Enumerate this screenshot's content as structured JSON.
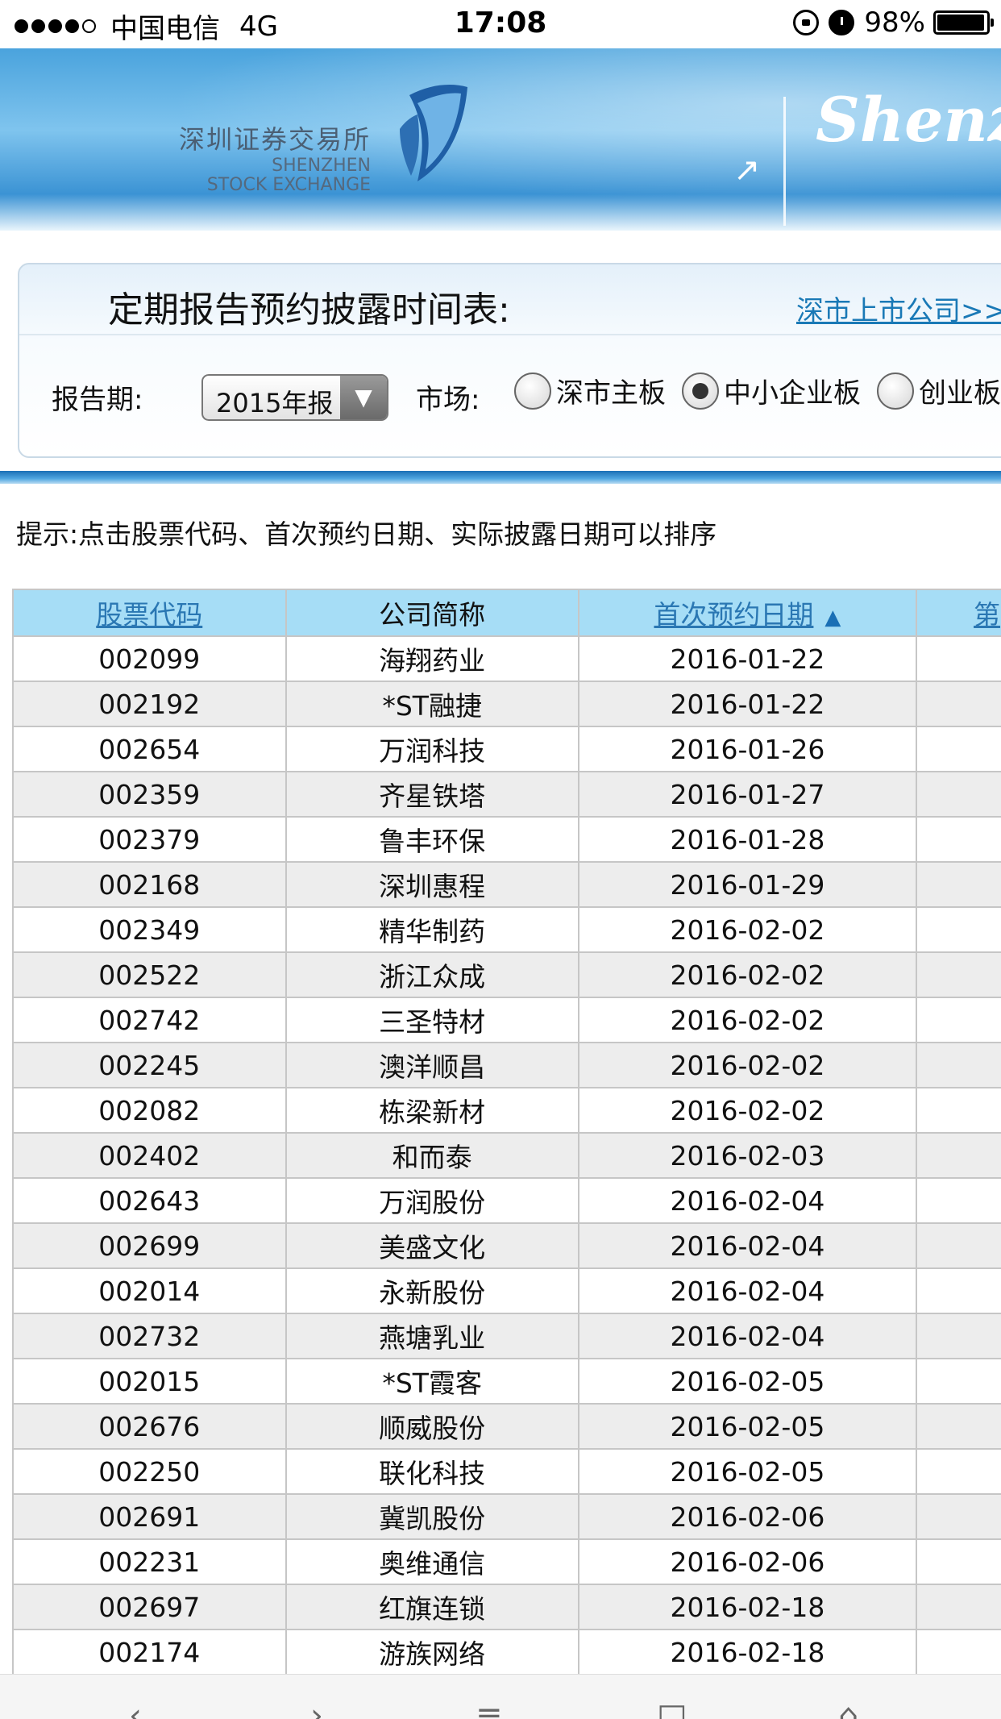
{
  "status_bar": {
    "carrier": "中国电信",
    "network": "4G",
    "time": "17:08",
    "battery_percent": "98%",
    "battery_level": 0.98
  },
  "banner": {
    "logo_cn": "深圳证券交易所",
    "logo_en_line1": "SHENZHEN",
    "logo_en_line2": "STOCK EXCHANGE",
    "title": "Shenzh"
  },
  "panel": {
    "title": "定期报告预约披露时间表:",
    "link": "深市上市公司>>>",
    "period_label": "报告期:",
    "period_value": "2015年报",
    "market_label": "市场:",
    "markets": [
      {
        "label": "深市主板",
        "checked": false
      },
      {
        "label": "中小企业板",
        "checked": true
      },
      {
        "label": "创业板",
        "checked": false
      }
    ]
  },
  "hint": "提示:点击股票代码、首次预约日期、实际披露日期可以排序",
  "table": {
    "headers": [
      "股票代码",
      "公司简称",
      "首次预约日期",
      "第"
    ],
    "rows": [
      [
        "002099",
        "海翔药业",
        "2016-01-22"
      ],
      [
        "002192",
        "*ST融捷",
        "2016-01-22"
      ],
      [
        "002654",
        "万润科技",
        "2016-01-26"
      ],
      [
        "002359",
        "齐星铁塔",
        "2016-01-27"
      ],
      [
        "002379",
        "鲁丰环保",
        "2016-01-28"
      ],
      [
        "002168",
        "深圳惠程",
        "2016-01-29"
      ],
      [
        "002349",
        "精华制药",
        "2016-02-02"
      ],
      [
        "002522",
        "浙江众成",
        "2016-02-02"
      ],
      [
        "002742",
        "三圣特材",
        "2016-02-02"
      ],
      [
        "002245",
        "澳洋顺昌",
        "2016-02-02"
      ],
      [
        "002082",
        "栋梁新材",
        "2016-02-02"
      ],
      [
        "002402",
        "和而泰",
        "2016-02-03"
      ],
      [
        "002643",
        "万润股份",
        "2016-02-04"
      ],
      [
        "002699",
        "美盛文化",
        "2016-02-04"
      ],
      [
        "002014",
        "永新股份",
        "2016-02-04"
      ],
      [
        "002732",
        "燕塘乳业",
        "2016-02-04"
      ],
      [
        "002015",
        "*ST霞客",
        "2016-02-05"
      ],
      [
        "002676",
        "顺威股份",
        "2016-02-05"
      ],
      [
        "002250",
        "联化科技",
        "2016-02-05"
      ],
      [
        "002691",
        "冀凯股份",
        "2016-02-06"
      ],
      [
        "002231",
        "奥维通信",
        "2016-02-06"
      ],
      [
        "002697",
        "红旗连锁",
        "2016-02-18"
      ],
      [
        "002174",
        "游族网络",
        "2016-02-18"
      ]
    ]
  },
  "colors": {
    "header_bg": "#a6ddf6",
    "link": "#2a77b3",
    "banner": "#4aa3dd"
  }
}
